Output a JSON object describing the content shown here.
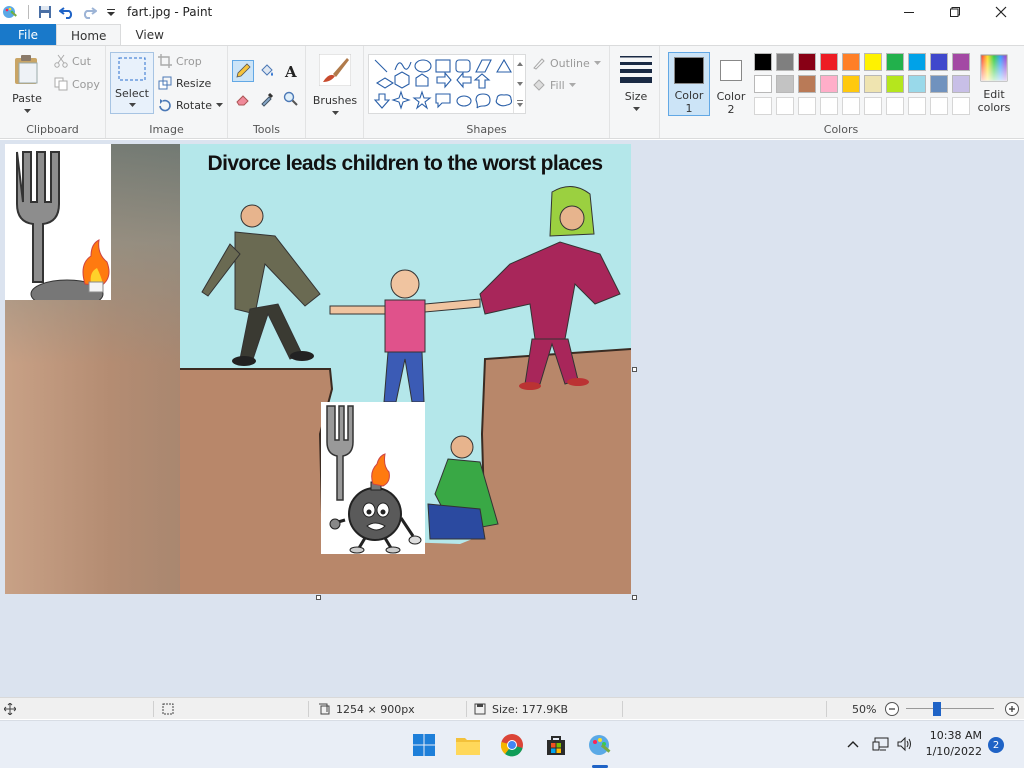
{
  "window": {
    "title": "fart.jpg - Paint"
  },
  "tabs": {
    "file": "File",
    "home": "Home",
    "view": "View"
  },
  "ribbon": {
    "clipboard": {
      "label": "Clipboard",
      "paste": "Paste",
      "cut": "Cut",
      "copy": "Copy"
    },
    "image": {
      "label": "Image",
      "select": "Select",
      "crop": "Crop",
      "resize": "Resize",
      "rotate": "Rotate"
    },
    "tools": {
      "label": "Tools"
    },
    "brushes": {
      "label": "Brushes"
    },
    "shapes": {
      "label": "Shapes",
      "outline": "Outline",
      "fill": "Fill"
    },
    "size": {
      "label": "Size"
    },
    "color1": {
      "label": "Color",
      "num": "1"
    },
    "color2": {
      "label": "Color",
      "num": "2"
    },
    "colors": {
      "label": "Colors",
      "edit_label": "Edit",
      "edit_label2": "colors",
      "row1": [
        "#000000",
        "#7f7f7f",
        "#880015",
        "#ed1c24",
        "#ff7f27",
        "#fff200",
        "#22b14c",
        "#00a2e8",
        "#3f48cc",
        "#a349a4"
      ],
      "row2": [
        "#ffffff",
        "#c3c3c3",
        "#b97a57",
        "#ffaec9",
        "#ffc90e",
        "#efe4b0",
        "#b5e61d",
        "#99d9ea",
        "#7092be",
        "#c8bfe7"
      ]
    }
  },
  "canvas": {
    "cartoon_title": "Divorce leads children to the worst places"
  },
  "statusbar": {
    "dimensions": "1254 × 900px",
    "size": "Size: 177.9KB",
    "zoom": "50%"
  },
  "taskbar": {
    "time": "10:38 AM",
    "date": "1/10/2022",
    "notifications": "2"
  }
}
